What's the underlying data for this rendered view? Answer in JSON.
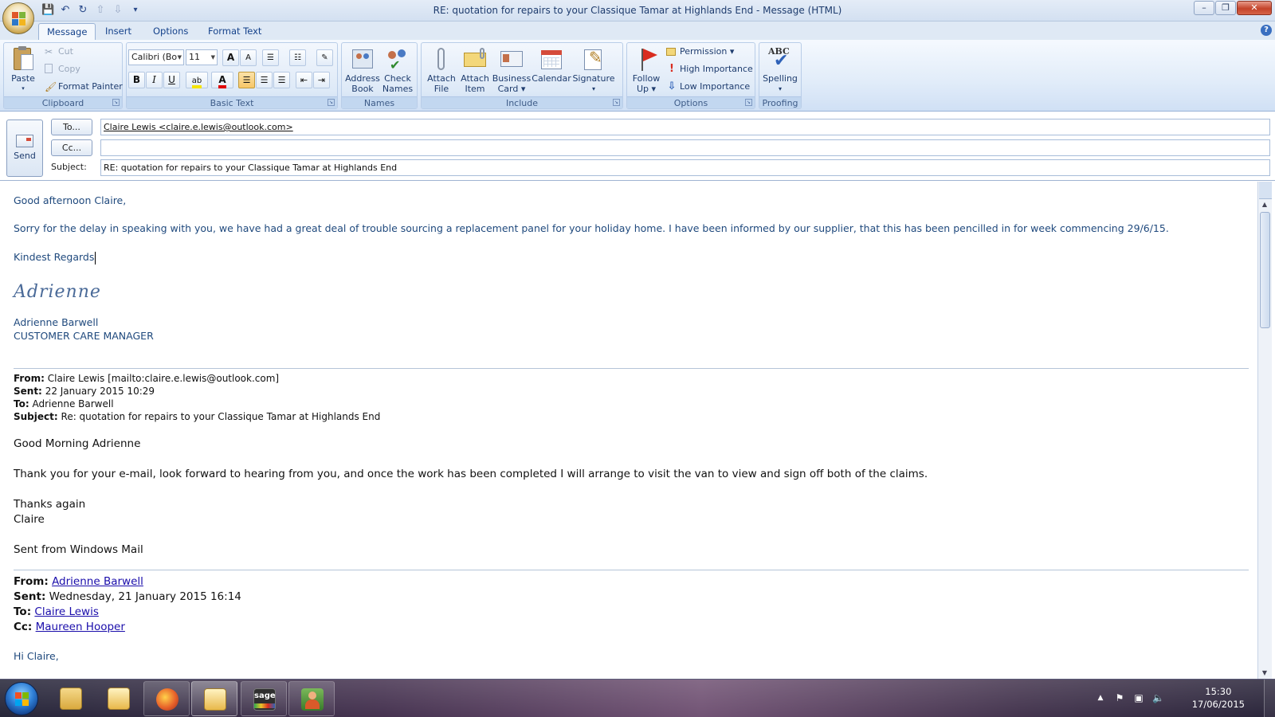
{
  "window": {
    "title": "RE: quotation for repairs to your Classique Tamar at Highlands End - Message (HTML)",
    "min": "–",
    "max": "❐",
    "close": "✕"
  },
  "qat": {
    "save": "💾",
    "undo": "↶",
    "redo": "↻",
    "up": "⇧",
    "down": "⇩",
    "more": "▾"
  },
  "tabs": [
    "Message",
    "Insert",
    "Options",
    "Format Text"
  ],
  "help": "?",
  "ribbon": {
    "clipboard": {
      "label": "Clipboard",
      "paste": "Paste",
      "cut": "Cut",
      "copy": "Copy",
      "format_painter": "Format Painter"
    },
    "basic_text": {
      "label": "Basic Text",
      "font": "Calibri (Bo",
      "size": "11",
      "grow": "A",
      "shrink": "A",
      "bold": "B",
      "italic": "I",
      "underline": "U"
    },
    "names": {
      "label": "Names",
      "address_book": [
        "Address",
        "Book"
      ],
      "check_names": [
        "Check",
        "Names"
      ]
    },
    "include": {
      "label": "Include",
      "attach_file": [
        "Attach",
        "File"
      ],
      "attach_item": [
        "Attach",
        "Item"
      ],
      "business_card": [
        "Business",
        "Card ▾"
      ],
      "calendar": "Calendar",
      "signature": [
        "Signature",
        "▾"
      ]
    },
    "options": {
      "label": "Options",
      "follow_up": [
        "Follow",
        "Up ▾"
      ],
      "permission": "Permission ▾",
      "high": "High Importance",
      "low": "Low Importance"
    },
    "proofing": {
      "label": "Proofing",
      "spelling": [
        "Spelling",
        "▾"
      ],
      "abc": "ABC"
    }
  },
  "header": {
    "send": "Send",
    "to_btn": "To...",
    "cc_btn": "Cc...",
    "subject_label": "Subject:",
    "to_value": "Claire Lewis <claire.e.lewis@outlook.com>",
    "cc_value": "",
    "subject_value": "RE: quotation for repairs to your Classique Tamar at Highlands End"
  },
  "body": {
    "greeting": "Good afternoon Claire,",
    "para1": "Sorry for the delay in speaking with you, we have had a great deal of trouble sourcing a replacement panel for your holiday home.  I have been informed by our supplier, that this has been pencilled in for week commencing 29/6/15.",
    "regards": "Kindest Regards",
    "signature_script": "Adrienne",
    "sig_name": "Adrienne Barwell",
    "sig_title": "CUSTOMER CARE MANAGER",
    "reply1": {
      "from_label": "From:",
      "from": "Claire Lewis [mailto:claire.e.lewis@outlook.com]",
      "sent_label": "Sent:",
      "sent": "22 January 2015 10:29",
      "to_label": "To:",
      "to": "Adrienne Barwell",
      "subject_label": "Subject:",
      "subject": "Re: quotation for repairs to your Classique Tamar at Highlands End",
      "greeting": "Good Morning Adrienne",
      "text": "Thank you for your e-mail, look forward to hearing from you, and once the work has been completed I will arrange to visit the van to view and sign off both of the claims.",
      "thanks": "Thanks again",
      "name": "Claire",
      "sent_from": "Sent from Windows Mail"
    },
    "reply2": {
      "from_label": "From:",
      "from": "Adrienne Barwell",
      "sent_label": "Sent:",
      "sent": "Wednesday, 21 January 2015 16:14",
      "to_label": "To:",
      "to": "Claire Lewis",
      "cc_label": "Cc:",
      "cc": "Maureen Hooper",
      "greeting": "Hi Claire,"
    }
  },
  "taskbar": {
    "sage_label": "sage",
    "time": "15:30",
    "date": "17/06/2015"
  },
  "colors": {
    "ribbon_text": "#1e3c6e",
    "body_text": "#1f497d",
    "link": "#1a0dab"
  }
}
